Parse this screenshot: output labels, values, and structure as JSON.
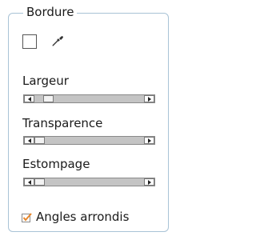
{
  "group": {
    "title": "Bordure"
  },
  "color": {
    "swatch_icon": "white-color-swatch",
    "picker_icon": "eyedropper-icon"
  },
  "sliders": [
    {
      "label": "Largeur",
      "value": 0.09
    },
    {
      "label": "Transparence",
      "value": 0.0
    },
    {
      "label": "Estompage",
      "value": 0.0
    }
  ],
  "checkbox": {
    "label": "Angles arrondis",
    "checked": true,
    "check_color": "#e8862a"
  }
}
